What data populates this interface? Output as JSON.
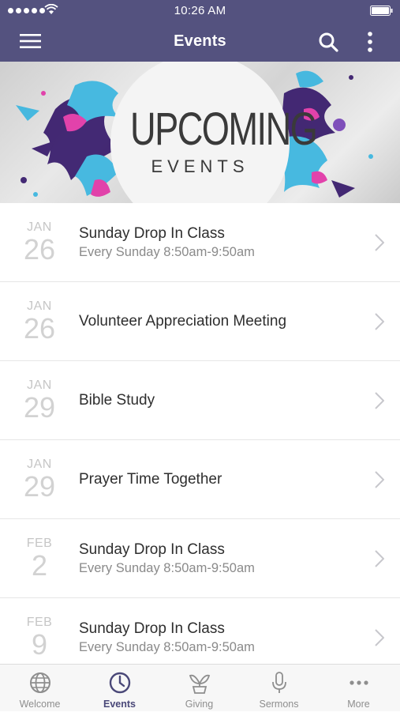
{
  "status_bar": {
    "time": "10:26 AM"
  },
  "nav": {
    "title": "Events"
  },
  "banner": {
    "line1": "UPCOMING",
    "line2": "EVENTS"
  },
  "events": [
    {
      "month": "JAN",
      "day": "26",
      "title": "Sunday Drop In Class",
      "subtitle": "Every Sunday 8:50am-9:50am"
    },
    {
      "month": "JAN",
      "day": "26",
      "title": "Volunteer Appreciation Meeting",
      "subtitle": ""
    },
    {
      "month": "JAN",
      "day": "29",
      "title": "Bible Study",
      "subtitle": ""
    },
    {
      "month": "JAN",
      "day": "29",
      "title": "Prayer Time Together",
      "subtitle": ""
    },
    {
      "month": "FEB",
      "day": "2",
      "title": "Sunday Drop In Class",
      "subtitle": "Every Sunday 8:50am-9:50am"
    },
    {
      "month": "FEB",
      "day": "9",
      "title": "Sunday Drop In Class",
      "subtitle": "Every Sunday 8:50am-9:50am"
    }
  ],
  "tabs": [
    {
      "label": "Welcome",
      "icon": "globe-icon",
      "active": false
    },
    {
      "label": "Events",
      "icon": "clock-icon",
      "active": true
    },
    {
      "label": "Giving",
      "icon": "plant-icon",
      "active": false
    },
    {
      "label": "Sermons",
      "icon": "microphone-icon",
      "active": false
    },
    {
      "label": "More",
      "icon": "more-dots-icon",
      "active": false
    }
  ],
  "colors": {
    "header": "#54527f",
    "active_tab": "#4a4878",
    "inactive_tab": "#8e8e8e",
    "splash_purple": "#3b1f6e",
    "splash_cyan": "#3fb7e0",
    "splash_pink": "#e23aa8"
  }
}
